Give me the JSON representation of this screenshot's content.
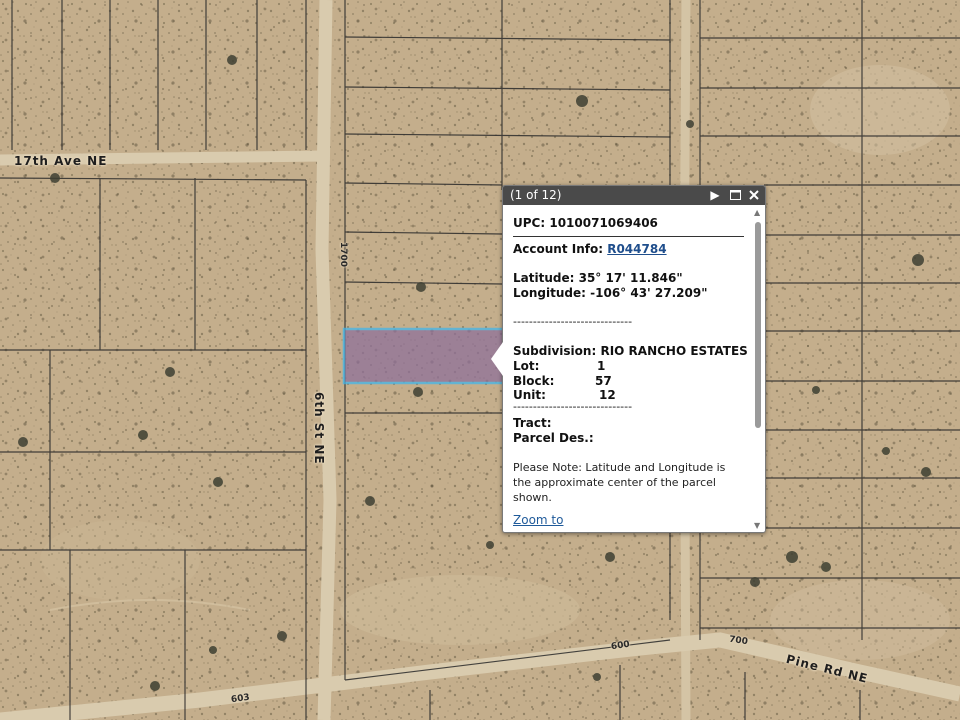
{
  "map": {
    "roads": {
      "ave_17th": "17th Ave NE",
      "st_6th": "6th St NE",
      "pine_rd": "Pine Rd NE"
    },
    "address_labels": {
      "a1700": "1700",
      "a600": "600",
      "a700": "700",
      "a603": "603"
    },
    "colors": {
      "ground": "#c4ae8c",
      "road": "#d8c9ac",
      "parcel_line": "#2a2a2a",
      "selected_fill": "#8e6f9a",
      "selected_outline": "#3fb6ee"
    }
  },
  "popup": {
    "counter": "(1 of 12)",
    "icons": {
      "next": "play-icon",
      "maximize": "maximize-icon",
      "close": "close-icon"
    },
    "upc_label": "UPC:",
    "upc_value": "1010071069406",
    "account_label": "Account Info:",
    "account_value": "R044784",
    "latitude_label": "Latitude:",
    "latitude_value": "35° 17' 11.846\"",
    "longitude_label": "Longitude:",
    "longitude_value": "-106° 43' 27.209\"",
    "separator": "------------------------------",
    "subdivision_label": "Subdivision:",
    "subdivision_value": "RIO RANCHO ESTATES",
    "lot_label": "Lot:",
    "lot_value": "1",
    "block_label": "Block:",
    "block_value": "57",
    "unit_label": "Unit:",
    "unit_value": "12",
    "tract_label": "Tract:",
    "parcel_des_label": "Parcel Des.:",
    "note": "Please Note: Latitude and Longitude is the approximate center of the parcel shown.",
    "zoom_link": "Zoom to"
  }
}
